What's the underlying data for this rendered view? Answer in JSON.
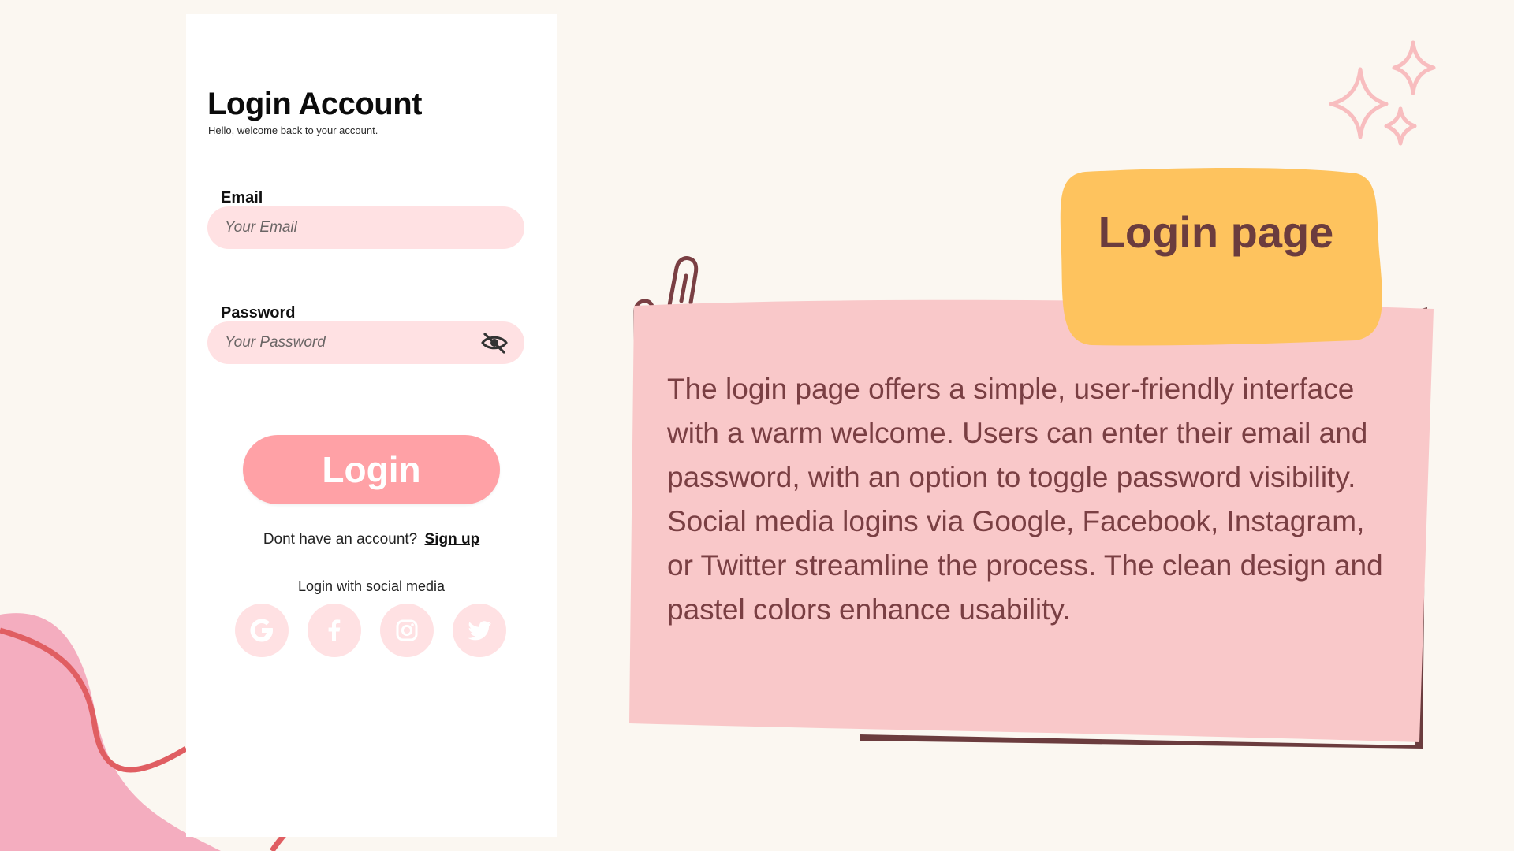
{
  "login_card": {
    "title": "Login Account",
    "subtitle": "Hello, welcome back to your account.",
    "email_label": "Email",
    "email_placeholder": "Your Email",
    "password_label": "Password",
    "password_placeholder": "Your Password",
    "login_button": "Login",
    "signup_prompt": "Dont have an account?",
    "signup_link": "Sign up",
    "social_label": "Login with social media",
    "social_icons": [
      "google-icon",
      "facebook-icon",
      "instagram-icon",
      "twitter-icon"
    ]
  },
  "info": {
    "tag_title": "Login page",
    "description": "The login page offers a simple, user-friendly interface with a warm welcome. Users can enter their email and password, with an option to toggle password visibility. Social media logins via Google, Facebook, Instagram, or Twitter streamline the process. The clean design and pastel colors enhance usability."
  },
  "colors": {
    "background": "#fbf7f1",
    "input_fill": "#ffe1e3",
    "button_fill": "#ffa1a6",
    "note_fill": "#f9c8c9",
    "note_text": "#7a3f43",
    "tag_fill": "#fec35e",
    "accent_dark": "#6b3c3e",
    "blob_pink": "#f4adbf",
    "blob_line": "#e05e62"
  }
}
